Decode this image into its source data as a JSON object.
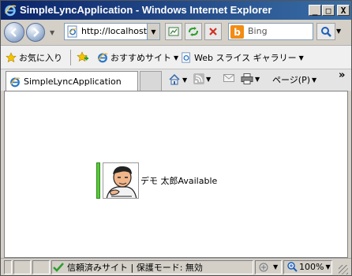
{
  "window": {
    "title": "SimpleLyncApplication - Windows Internet Explorer",
    "controls": {
      "minimize": "_",
      "maximize": "□",
      "close": "X"
    }
  },
  "navigation": {
    "address": "http://localhost",
    "search_placeholder": "Bing"
  },
  "favorites_bar": {
    "favorites_label": "お気に入り",
    "suggested_sites_label": "おすすめサイト",
    "web_slice_gallery_label": "Web スライス ギャラリー"
  },
  "command_bar": {
    "tab_title": "SimpleLyncApplication",
    "page_menu_label": "ページ(P)",
    "chevron": "»"
  },
  "content": {
    "contact_name": "デモ 太郎",
    "presence_status": "Available",
    "presence_color": "#5cc83a"
  },
  "status_bar": {
    "zone_text": "信頼済みサイト | 保護モード: 無効",
    "zoom": "100%"
  }
}
